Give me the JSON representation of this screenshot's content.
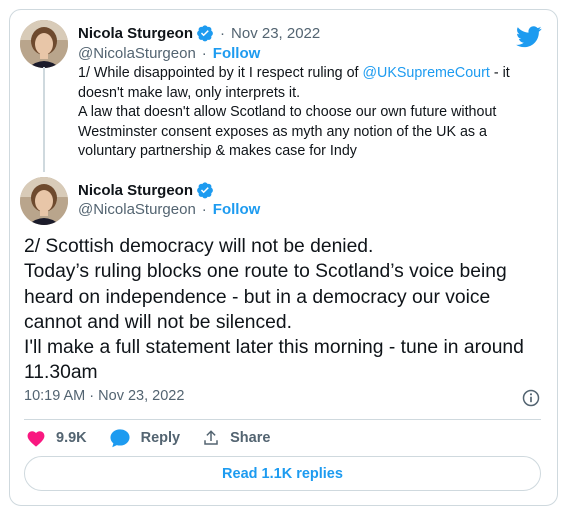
{
  "twitter_logo": "twitter-bird-icon",
  "tweet1": {
    "name": "Nicola Sturgeon",
    "date": "Nov 23, 2022",
    "handle": "@NicolaSturgeon",
    "follow": "Follow",
    "text_start": "1/ While disappointed by it I respect ruling of ",
    "mention": "@UKSupremeCourt",
    "text_mid": " - it doesn't make law, only interprets it.",
    "text_line2": "A law that doesn't allow Scotland to choose our own future without Westminster consent exposes as myth any notion of the UK as a voluntary partnership & makes case for Indy"
  },
  "tweet2": {
    "name": "Nicola Sturgeon",
    "handle": "@NicolaSturgeon",
    "follow": "Follow",
    "line1": "2/ Scottish democracy will not be denied.",
    "line2": "Today’s ruling blocks one route to Scotland’s voice being heard on independence - but in a democracy our voice cannot and will not be silenced.",
    "line3": "I'll make a full statement later this morning - tune in around 11.30am",
    "time": "10:19 AM",
    "date": "Nov 23, 2022"
  },
  "actions": {
    "likes": "9.9K",
    "reply": "Reply",
    "share": "Share"
  },
  "read_replies": "Read 1.1K replies",
  "colors": {
    "accent": "#1d9bf0",
    "like": "#f91880",
    "text_secondary": "#536471",
    "border": "#cfd9de"
  }
}
